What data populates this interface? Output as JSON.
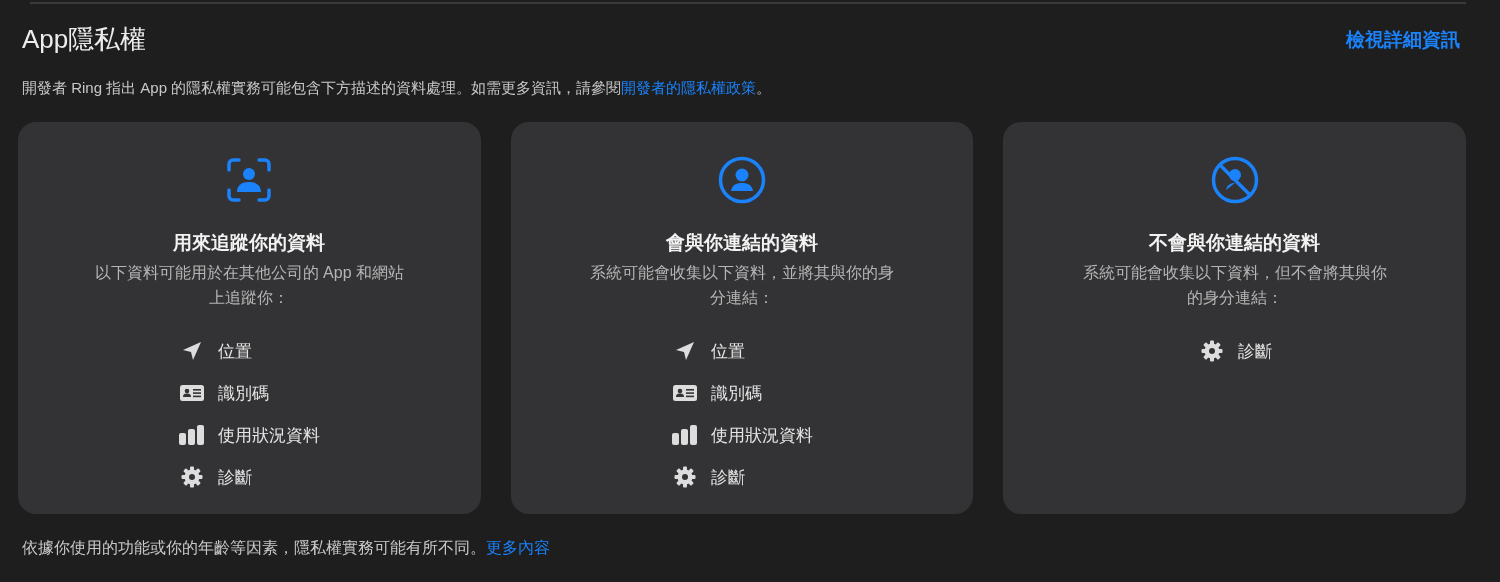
{
  "header": {
    "title": "App隱私權",
    "link": "檢視詳細資訊"
  },
  "description": {
    "text": "開發者 Ring 指出 App 的隱私權實務可能包含下方描述的資料處理。如需更多資訊，請參閱",
    "link": "開發者的隱私權政策",
    "after": "。"
  },
  "cards": [
    {
      "kind": "tracking",
      "title": "用來追蹤你的資料",
      "subtitle": "以下資料可能用於在其他公司的 App 和網站上追蹤你：",
      "items": [
        {
          "kind": "location",
          "label": "位置"
        },
        {
          "kind": "id",
          "label": "識別碼"
        },
        {
          "kind": "usage",
          "label": "使用狀況資料"
        },
        {
          "kind": "diagnostics",
          "label": "診斷"
        }
      ]
    },
    {
      "kind": "linked",
      "title": "會與你連結的資料",
      "subtitle": "系統可能會收集以下資料，並將其與你的身分連結：",
      "items": [
        {
          "kind": "location",
          "label": "位置"
        },
        {
          "kind": "id",
          "label": "識別碼"
        },
        {
          "kind": "usage",
          "label": "使用狀況資料"
        },
        {
          "kind": "diagnostics",
          "label": "診斷"
        }
      ]
    },
    {
      "kind": "not_linked",
      "title": "不會與你連結的資料",
      "subtitle": "系統可能會收集以下資料，但不會將其與你的身分連結：",
      "items": [
        {
          "kind": "diagnostics",
          "label": "診斷"
        }
      ]
    }
  ],
  "footer": {
    "text": "依據你使用的功能或你的年齡等因素，隱私權實務可能有所不同。",
    "link": "更多內容"
  }
}
